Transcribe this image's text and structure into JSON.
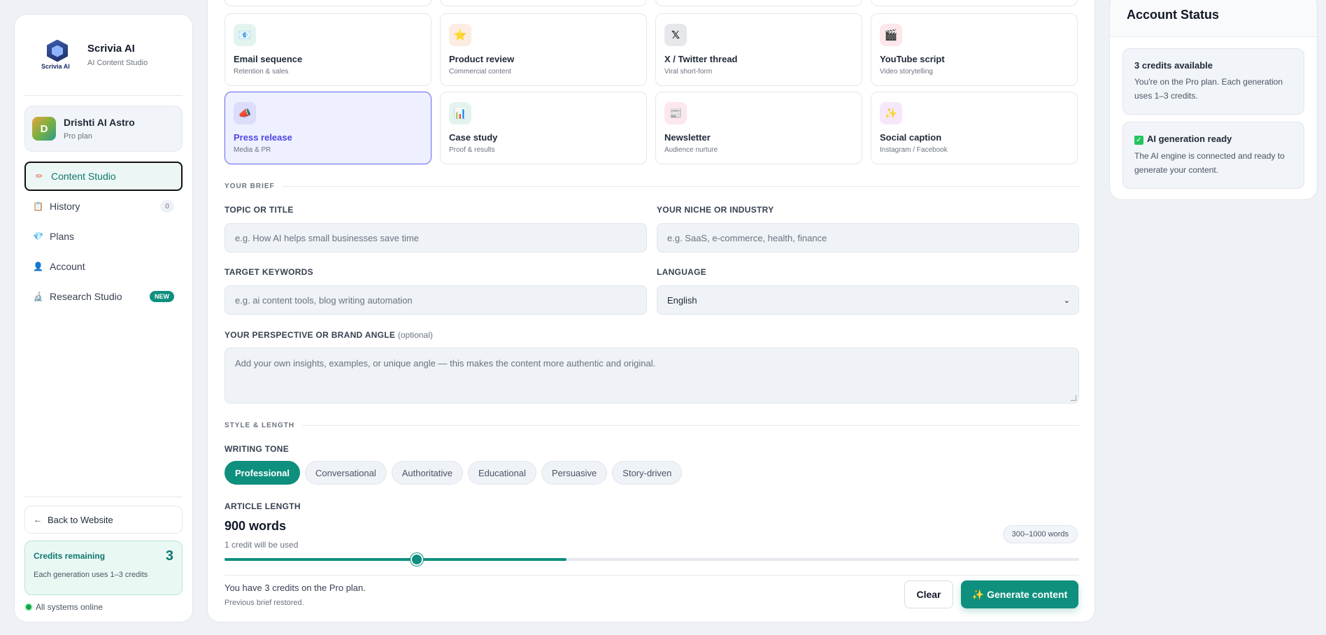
{
  "brand": {
    "name": "Scrivia AI",
    "subtitle": "AI Content Studio",
    "logo_word": "Scrivia AI"
  },
  "user": {
    "initial": "D",
    "name": "Drishti AI Astro",
    "plan": "Pro plan"
  },
  "nav": [
    {
      "label": "Content Studio",
      "icon": "pencil-icon",
      "glyph": "✏",
      "active": true
    },
    {
      "label": "History",
      "icon": "clipboard-icon",
      "glyph": "📋",
      "count": "0"
    },
    {
      "label": "Plans",
      "icon": "diamond-icon",
      "glyph": "💎"
    },
    {
      "label": "Account",
      "icon": "user-icon",
      "glyph": "👤"
    },
    {
      "label": "Research Studio",
      "icon": "microscope-icon",
      "glyph": "🔬",
      "badge": "NEW"
    }
  ],
  "sidebar_bottom": {
    "back_label": "Back to Website",
    "credits_label": "Credits remaining",
    "credits_value": "3",
    "credits_sub": "Each generation uses 1–3 credits",
    "status_text": "All systems online"
  },
  "templates": [
    {
      "name": "Email sequence",
      "sub": "Retention & sales",
      "icon": "email-icon",
      "glyph": "📧",
      "bg": "#e3f4ef"
    },
    {
      "name": "Product review",
      "sub": "Commercial content",
      "icon": "star-icon",
      "glyph": "⭐",
      "bg": "#fdece4"
    },
    {
      "name": "X / Twitter thread",
      "sub": "Viral short-form",
      "icon": "x-logo-icon",
      "glyph": "𝕏",
      "bg": "#e5e7eb"
    },
    {
      "name": "YouTube script",
      "sub": "Video storytelling",
      "icon": "clapper-icon",
      "glyph": "🎬",
      "bg": "#fde7ea"
    },
    {
      "name": "Press release",
      "sub": "Media & PR",
      "icon": "megaphone-icon",
      "glyph": "📣",
      "bg": "#dcdcfb",
      "selected": true
    },
    {
      "name": "Case study",
      "sub": "Proof & results",
      "icon": "bar-chart-icon",
      "glyph": "📊",
      "bg": "#e3f4ef"
    },
    {
      "name": "Newsletter",
      "sub": "Audience nurture",
      "icon": "newspaper-icon",
      "glyph": "📰",
      "bg": "#fde7ef"
    },
    {
      "name": "Social caption",
      "sub": "Instagram / Facebook",
      "icon": "sparkle-icon",
      "glyph": "✨",
      "bg": "#f5e8fb"
    }
  ],
  "brief": {
    "section_title": "YOUR BRIEF",
    "topic_label": "TOPIC OR TITLE",
    "topic_placeholder": "e.g. How AI helps small businesses save time",
    "niche_label": "YOUR NICHE OR INDUSTRY",
    "niche_placeholder": "e.g. SaaS, e-commerce, health, finance",
    "keywords_label": "TARGET KEYWORDS",
    "keywords_placeholder": "e.g. ai content tools, blog writing automation",
    "language_label": "LANGUAGE",
    "language_value": "English",
    "perspective_label": "YOUR PERSPECTIVE OR BRAND ANGLE",
    "perspective_optional": "(optional)",
    "perspective_placeholder": "Add your own insights, examples, or unique angle — this makes the content more authentic and original."
  },
  "style": {
    "section_title": "STYLE & LENGTH",
    "tone_label": "WRITING TONE",
    "tones": [
      "Professional",
      "Conversational",
      "Authoritative",
      "Educational",
      "Persuasive",
      "Story-driven"
    ],
    "active_tone": 0,
    "length_label": "ARTICLE LENGTH",
    "words": "900 words",
    "credit_note": "1 credit will be used",
    "range_pill": "300–1000 words",
    "slider_fraction": 0.225
  },
  "footer": {
    "credits_text": "You have 3 credits on the Pro plan.",
    "restored_text": "Previous brief restored.",
    "clear_label": "Clear",
    "generate_label": "✨ Generate content"
  },
  "account_status": {
    "title": "Account Status",
    "credits_title": "3 credits available",
    "credits_desc": "You're on the Pro plan. Each generation uses 1–3 credits.",
    "ai_title": "AI generation ready",
    "ai_desc": "The AI engine is connected and ready to generate your content."
  },
  "colors": {
    "accent": "#0f8f7e",
    "selected_card": "#6366f1",
    "background": "#eef1f6"
  }
}
